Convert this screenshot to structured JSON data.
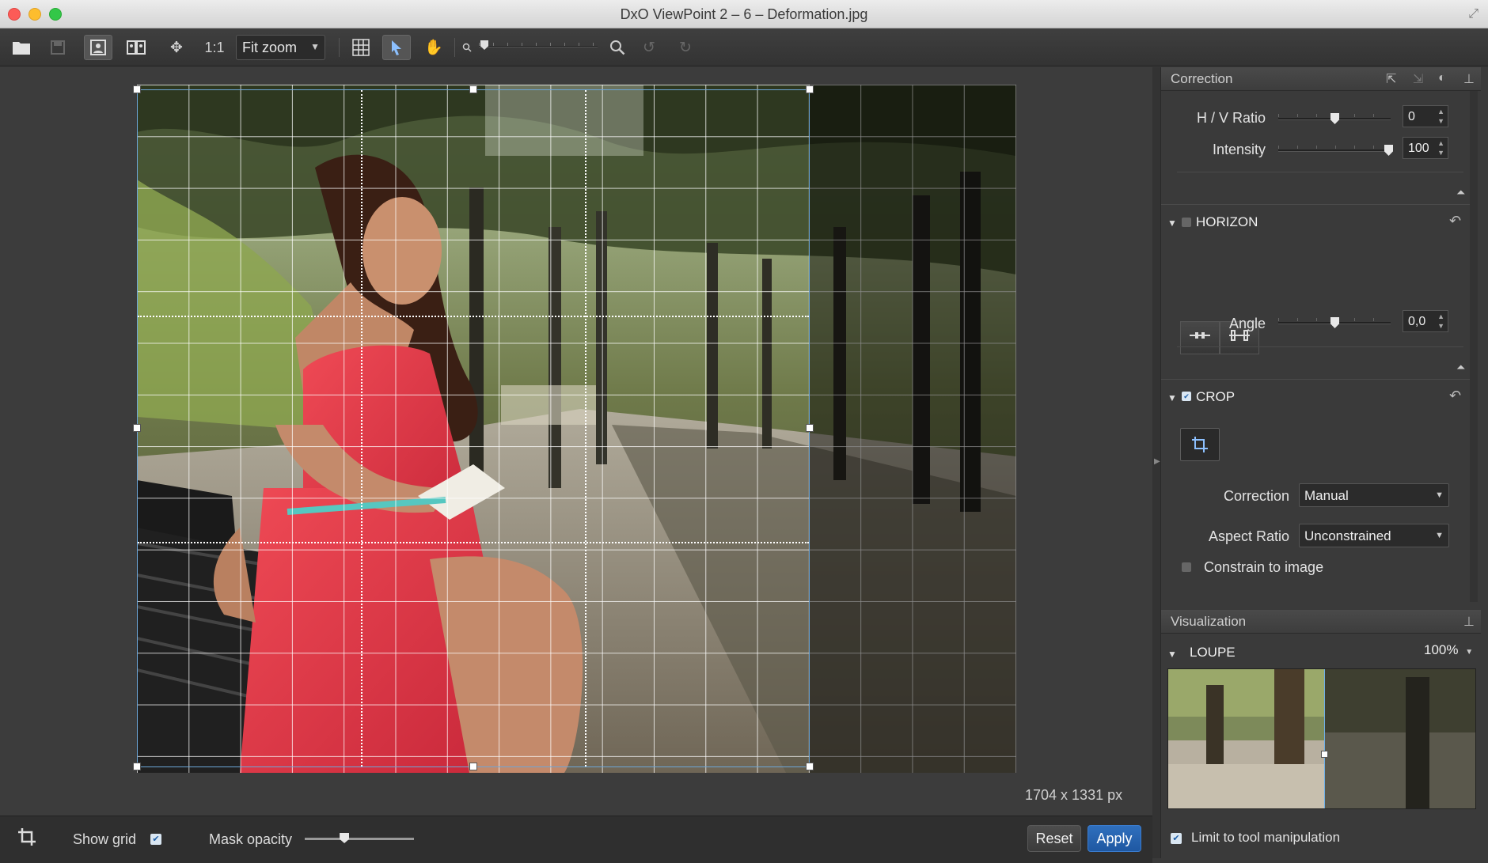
{
  "window": {
    "title": "DxO ViewPoint 2 – 6 – Deformation.jpg"
  },
  "toolbar": {
    "one_to_one": "1:1",
    "zoom_value": "Fit zoom"
  },
  "canvas": {
    "image_size": "1704 x 1331 px"
  },
  "bottom_bar": {
    "show_grid_label": "Show grid",
    "show_grid_checked": true,
    "mask_opacity_label": "Mask opacity",
    "mask_opacity": 0.35,
    "reset_label": "Reset",
    "apply_label": "Apply"
  },
  "panel": {
    "correction_header": "Correction",
    "hv_ratio": {
      "label": "H / V Ratio",
      "value": "0"
    },
    "intensity": {
      "label": "Intensity",
      "value": "100"
    },
    "horizon": {
      "title": "HORIZON",
      "angle_label": "Angle",
      "angle_value": "0,0"
    },
    "crop": {
      "title": "CROP",
      "checked": true,
      "correction_label": "Correction",
      "correction_value": "Manual",
      "aspect_label": "Aspect Ratio",
      "aspect_value": "Unconstrained",
      "constrain_label": "Constrain to image",
      "constrain_checked": false
    },
    "visualization_header": "Visualization",
    "loupe": {
      "title": "LOUPE",
      "zoom": "100%"
    },
    "limit_label": "Limit to tool manipulation",
    "limit_checked": true
  },
  "colors": {
    "accent": "#2f6fbd",
    "crop_frame": "#6ca6d8"
  }
}
